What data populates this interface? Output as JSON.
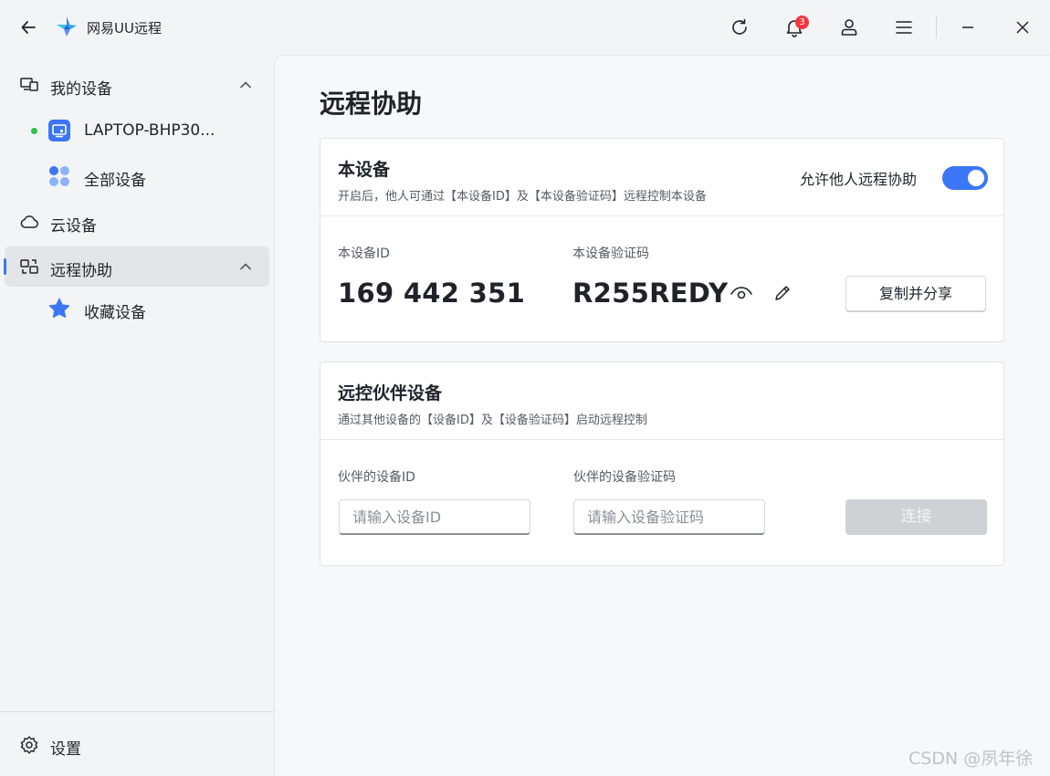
{
  "app": {
    "title": "网易UU远程",
    "notification_count": "3"
  },
  "sidebar": {
    "my_devices": "我的设备",
    "laptop": "LAPTOP-BHP30...",
    "all_devices": "全部设备",
    "cloud_devices": "云设备",
    "remote_assist": "远程协助",
    "favorites": "收藏设备",
    "settings": "设置"
  },
  "main": {
    "title": "远程协助",
    "this_device": {
      "title": "本设备",
      "description": "开启后，他人可通过【本设备ID】及【本设备验证码】远程控制本设备",
      "allow_label": "允许他人远程协助",
      "allow_enabled": true,
      "id_label": "本设备ID",
      "id_value": "169 442 351",
      "code_label": "本设备验证码",
      "code_value": "R255REDY",
      "copy_share": "复制并分享"
    },
    "partner": {
      "title": "远控伙伴设备",
      "description": "通过其他设备的【设备ID】及【设备验证码】启动远程控制",
      "id_label": "伙伴的设备ID",
      "id_placeholder": "请输入设备ID",
      "code_label": "伙伴的设备验证码",
      "code_placeholder": "请输入设备验证码",
      "connect": "连接"
    }
  },
  "colors": {
    "accent": "#3b76f6",
    "online": "#2ec24a",
    "badge": "#f5363d"
  },
  "watermark": "CSDN @夙年徐"
}
